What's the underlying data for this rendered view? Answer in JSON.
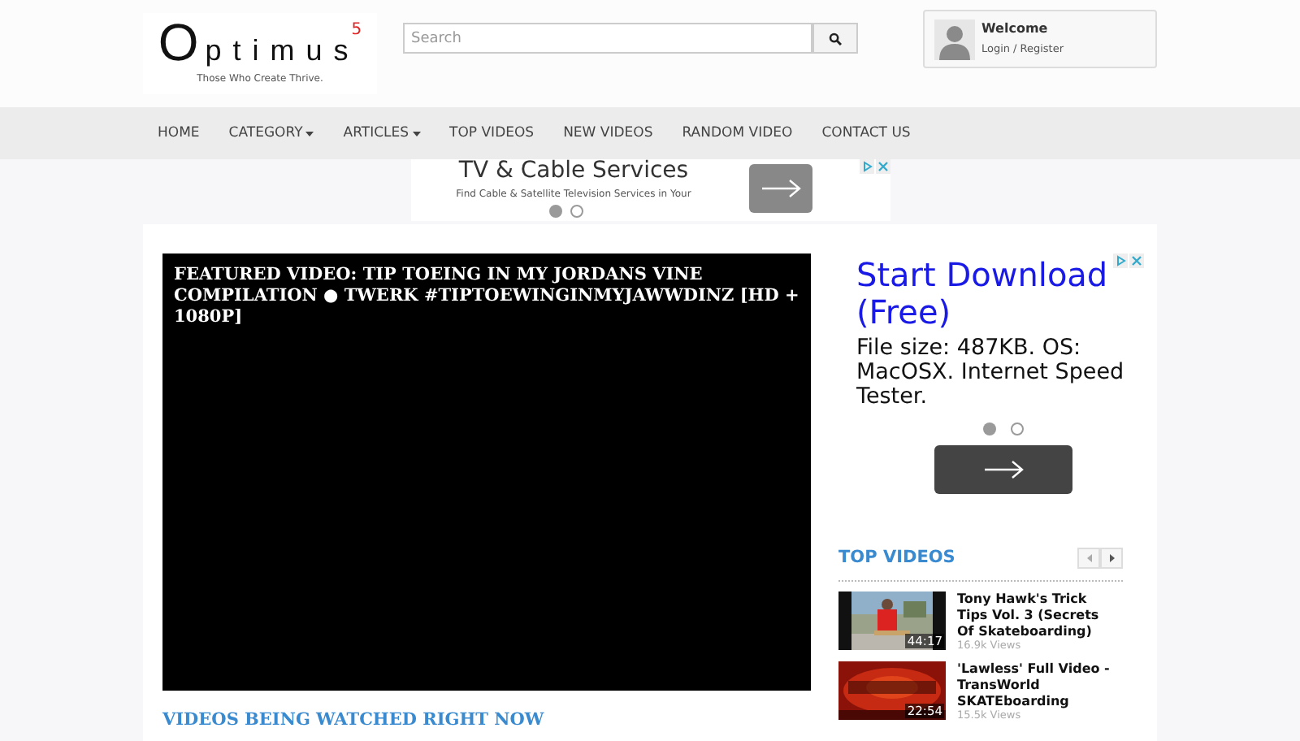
{
  "logo": {
    "letter": "O",
    "word": "ptimus",
    "superscript": "5",
    "tagline": "Those Who Create Thrive."
  },
  "search": {
    "placeholder": "Search"
  },
  "user": {
    "welcome": "Welcome",
    "login": "Login",
    "separator": "/",
    "register": "Register"
  },
  "nav": [
    {
      "label": "HOME",
      "dropdown": false
    },
    {
      "label": "CATEGORY",
      "dropdown": true
    },
    {
      "label": "ARTICLES",
      "dropdown": true
    },
    {
      "label": "TOP VIDEOS",
      "dropdown": false
    },
    {
      "label": "NEW VIDEOS",
      "dropdown": false
    },
    {
      "label": "RANDOM VIDEO",
      "dropdown": false
    },
    {
      "label": "CONTACT US",
      "dropdown": false
    }
  ],
  "top_ad": {
    "title": "TV & Cable Services",
    "text": "Find Cable & Satellite Television Services in Your",
    "dots": [
      {
        "selected": true
      },
      {
        "selected": false
      }
    ]
  },
  "featured": {
    "title": "FEATURED VIDEO: TIP TOEING IN MY JORDANS VINE COMPILATION ● TWERK #TIPTOEWINGINMYJAWWDINZ [HD + 1080P]"
  },
  "watching_heading": "VIDEOS BEING WATCHED RIGHT NOW",
  "side_ad": {
    "title": "Start Download (Free)",
    "text": "File size: 487KB. OS: MacOSX. Internet Speed Tester.",
    "dots": [
      {
        "selected": true
      },
      {
        "selected": false
      }
    ]
  },
  "top_videos": {
    "heading": "TOP VIDEOS",
    "items": [
      {
        "title": "Tony Hawk's Trick Tips Vol. 3 (Secrets Of Skateboarding)",
        "duration": "44:17",
        "views": "16.9k Views"
      },
      {
        "title": "'Lawless' Full Video - TransWorld SKATEboarding",
        "duration": "22:54",
        "views": "15.5k Views"
      }
    ]
  }
}
